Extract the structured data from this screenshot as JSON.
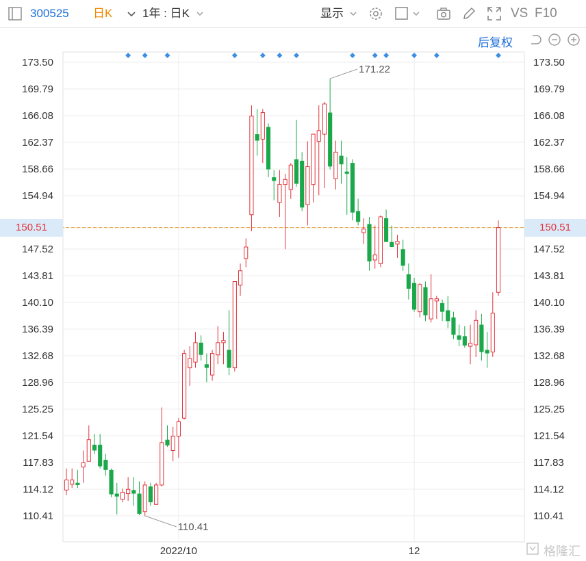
{
  "toolbar": {
    "stock_code": "300525",
    "period": "日K",
    "range": "1年 : 日K",
    "display": "显示",
    "vs": "VS",
    "f10": "F10",
    "code_color": "#1e6fd9",
    "period_color": "#f08a00"
  },
  "subbar": {
    "adjust_label": "后复权"
  },
  "current_price": "150.51",
  "watermark": "格隆汇",
  "chart_data": {
    "type": "candlestick",
    "title": "",
    "ylim": [
      110.41,
      173.5
    ],
    "y_ticks": [
      "173.50",
      "169.79",
      "166.08",
      "162.37",
      "158.66",
      "154.94",
      "150.51",
      "147.52",
      "143.81",
      "140.10",
      "136.39",
      "132.68",
      "128.96",
      "125.25",
      "121.54",
      "117.83",
      "114.12",
      "110.41"
    ],
    "x_ticks": [
      "2022/10",
      "12"
    ],
    "annotations": {
      "high": "171.22",
      "low": "110.41"
    },
    "reference_line": 150.51,
    "up_color": "#e0333a",
    "down_color": "#1aa84a",
    "event_marker_color": "#3d8fe6",
    "event_markers": 13,
    "candles": [
      {
        "o": 114.0,
        "h": 117.0,
        "l": 113.3,
        "c": 115.4
      },
      {
        "o": 114.8,
        "h": 117.0,
        "l": 114.3,
        "c": 115.4
      },
      {
        "o": 115.0,
        "h": 116.8,
        "l": 114.3,
        "c": 114.7
      },
      {
        "o": 117.2,
        "h": 119.5,
        "l": 115.0,
        "c": 117.8
      },
      {
        "o": 118.0,
        "h": 123.0,
        "l": 118.0,
        "c": 121.0
      },
      {
        "o": 120.3,
        "h": 121.8,
        "l": 119.0,
        "c": 119.5
      },
      {
        "o": 120.3,
        "h": 121.8,
        "l": 117.0,
        "c": 117.3
      },
      {
        "o": 118.2,
        "h": 119.0,
        "l": 116.0,
        "c": 116.8
      },
      {
        "o": 116.8,
        "h": 117.0,
        "l": 113.0,
        "c": 113.4
      },
      {
        "o": 113.5,
        "h": 115.0,
        "l": 110.6,
        "c": 113.1
      },
      {
        "o": 112.7,
        "h": 114.2,
        "l": 112.3,
        "c": 113.7
      },
      {
        "o": 113.5,
        "h": 115.8,
        "l": 112.5,
        "c": 114.1
      },
      {
        "o": 114.0,
        "h": 115.8,
        "l": 111.8,
        "c": 113.5
      },
      {
        "o": 113.5,
        "h": 115.2,
        "l": 110.5,
        "c": 110.7
      },
      {
        "o": 111.0,
        "h": 115.2,
        "l": 110.41,
        "c": 114.7
      },
      {
        "o": 114.5,
        "h": 115.0,
        "l": 111.8,
        "c": 112.3
      },
      {
        "o": 112.0,
        "h": 115.0,
        "l": 112.0,
        "c": 114.7
      },
      {
        "o": 114.7,
        "h": 125.5,
        "l": 114.5,
        "c": 120.6
      },
      {
        "o": 121.0,
        "h": 123.0,
        "l": 120.0,
        "c": 120.2
      },
      {
        "o": 119.5,
        "h": 122.8,
        "l": 118.0,
        "c": 121.5
      },
      {
        "o": 121.5,
        "h": 124.0,
        "l": 118.5,
        "c": 123.5
      },
      {
        "o": 124.0,
        "h": 133.5,
        "l": 123.8,
        "c": 133.0
      },
      {
        "o": 131.0,
        "h": 134.0,
        "l": 128.5,
        "c": 132.3
      },
      {
        "o": 131.8,
        "h": 136.0,
        "l": 131.0,
        "c": 134.5
      },
      {
        "o": 134.5,
        "h": 135.5,
        "l": 132.0,
        "c": 132.8
      },
      {
        "o": 131.5,
        "h": 133.0,
        "l": 129.0,
        "c": 131.0
      },
      {
        "o": 130.0,
        "h": 133.5,
        "l": 129.2,
        "c": 133.0
      },
      {
        "o": 132.8,
        "h": 136.8,
        "l": 131.5,
        "c": 134.5
      },
      {
        "o": 134.5,
        "h": 136.0,
        "l": 131.5,
        "c": 134.8
      },
      {
        "o": 133.5,
        "h": 139.0,
        "l": 130.0,
        "c": 131.0
      },
      {
        "o": 131.0,
        "h": 143.0,
        "l": 130.5,
        "c": 143.0
      },
      {
        "o": 142.5,
        "h": 145.5,
        "l": 141.0,
        "c": 144.5
      },
      {
        "o": 146.2,
        "h": 149.0,
        "l": 145.0,
        "c": 147.8
      },
      {
        "o": 152.3,
        "h": 167.5,
        "l": 150.0,
        "c": 166.0
      },
      {
        "o": 163.5,
        "h": 167.0,
        "l": 160.5,
        "c": 162.6
      },
      {
        "o": 162.8,
        "h": 167.0,
        "l": 159.5,
        "c": 166.5
      },
      {
        "o": 164.5,
        "h": 165.0,
        "l": 157.5,
        "c": 158.6
      },
      {
        "o": 157.5,
        "h": 158.5,
        "l": 154.3,
        "c": 157.0
      },
      {
        "o": 154.0,
        "h": 158.5,
        "l": 152.0,
        "c": 156.5
      },
      {
        "o": 156.5,
        "h": 158.0,
        "l": 147.5,
        "c": 157.2
      },
      {
        "o": 155.8,
        "h": 159.5,
        "l": 154.5,
        "c": 159.2
      },
      {
        "o": 160.0,
        "h": 165.5,
        "l": 156.2,
        "c": 156.6
      },
      {
        "o": 159.8,
        "h": 161.0,
        "l": 152.8,
        "c": 153.3
      },
      {
        "o": 153.7,
        "h": 162.5,
        "l": 150.8,
        "c": 159.0
      },
      {
        "o": 156.5,
        "h": 163.0,
        "l": 154.0,
        "c": 163.5
      },
      {
        "o": 162.5,
        "h": 167.5,
        "l": 155.0,
        "c": 164.0
      },
      {
        "o": 163.5,
        "h": 168.0,
        "l": 156.0,
        "c": 167.7
      },
      {
        "o": 166.5,
        "h": 171.22,
        "l": 158.6,
        "c": 159.0
      },
      {
        "o": 157.3,
        "h": 162.6,
        "l": 155.8,
        "c": 161.0
      },
      {
        "o": 160.5,
        "h": 162.6,
        "l": 156.6,
        "c": 159.3
      },
      {
        "o": 158.3,
        "h": 160.3,
        "l": 152.3,
        "c": 158.0
      },
      {
        "o": 159.5,
        "h": 160.0,
        "l": 151.5,
        "c": 152.6
      },
      {
        "o": 152.8,
        "h": 154.5,
        "l": 150.8,
        "c": 151.3
      },
      {
        "o": 149.8,
        "h": 151.8,
        "l": 148.2,
        "c": 150.3
      },
      {
        "o": 151.0,
        "h": 152.0,
        "l": 144.5,
        "c": 145.8
      },
      {
        "o": 146.0,
        "h": 150.8,
        "l": 144.8,
        "c": 146.7
      },
      {
        "o": 145.5,
        "h": 152.2,
        "l": 145.0,
        "c": 152.0
      },
      {
        "o": 151.8,
        "h": 153.0,
        "l": 149.3,
        "c": 148.5
      },
      {
        "o": 148.5,
        "h": 150.8,
        "l": 147.8,
        "c": 147.8
      },
      {
        "o": 148.2,
        "h": 149.5,
        "l": 146.3,
        "c": 148.6
      },
      {
        "o": 147.5,
        "h": 148.8,
        "l": 144.5,
        "c": 145.2
      },
      {
        "o": 144.0,
        "h": 145.5,
        "l": 140.5,
        "c": 142.0
      },
      {
        "o": 142.8,
        "h": 143.5,
        "l": 138.8,
        "c": 139.1
      },
      {
        "o": 138.8,
        "h": 142.8,
        "l": 138.0,
        "c": 142.6
      },
      {
        "o": 142.2,
        "h": 143.0,
        "l": 137.5,
        "c": 138.3
      },
      {
        "o": 137.8,
        "h": 144.0,
        "l": 137.3,
        "c": 140.6
      },
      {
        "o": 140.3,
        "h": 141.0,
        "l": 137.8,
        "c": 140.6
      },
      {
        "o": 140.0,
        "h": 140.5,
        "l": 137.5,
        "c": 138.8
      },
      {
        "o": 139.0,
        "h": 141.0,
        "l": 136.5,
        "c": 137.5
      },
      {
        "o": 138.0,
        "h": 138.8,
        "l": 135.0,
        "c": 135.6
      },
      {
        "o": 135.5,
        "h": 137.0,
        "l": 134.0,
        "c": 134.9
      },
      {
        "o": 135.4,
        "h": 136.8,
        "l": 133.8,
        "c": 134.1
      },
      {
        "o": 134.0,
        "h": 137.0,
        "l": 131.5,
        "c": 134.4
      },
      {
        "o": 134.2,
        "h": 139.0,
        "l": 132.5,
        "c": 137.6
      },
      {
        "o": 137.0,
        "h": 138.5,
        "l": 132.0,
        "c": 133.2
      },
      {
        "o": 133.5,
        "h": 136.0,
        "l": 131.0,
        "c": 133.0
      },
      {
        "o": 133.2,
        "h": 141.5,
        "l": 132.5,
        "c": 138.6
      },
      {
        "o": 141.5,
        "h": 151.5,
        "l": 141.0,
        "c": 150.51
      }
    ]
  }
}
